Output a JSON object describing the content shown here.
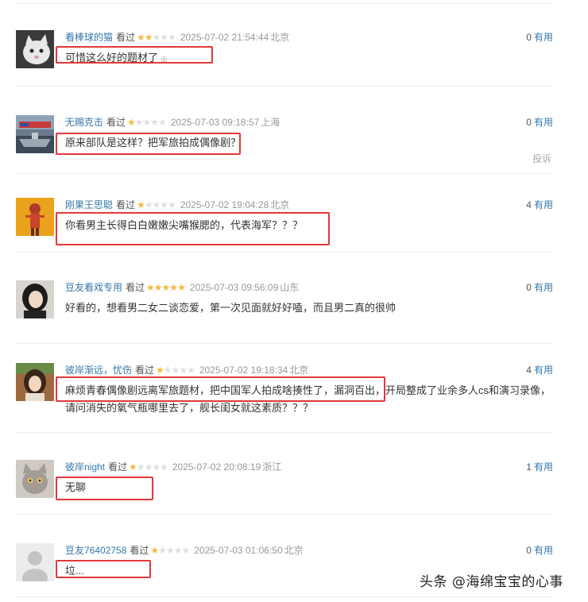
{
  "reviews": [
    {
      "user": "看棒球的猫",
      "seen": "看过",
      "rating": 2,
      "time": "2025-07-02 21:54:44",
      "location": "北京",
      "useful_count": "0",
      "useful_label": "有用",
      "content": "可惜这么好的题材了",
      "avatar_icon": "cat-avatar-icon"
    },
    {
      "user": "无赐克击",
      "seen": "看过",
      "rating": 1,
      "time": "2025-07-03 09:18:57",
      "location": "上海",
      "useful_count": "0",
      "useful_label": "有用",
      "content": "原来部队是这样？把军旅拍成偶像剧？",
      "report_label": "投诉",
      "avatar_icon": "ship-avatar-icon"
    },
    {
      "user": "刚果王思聪",
      "seen": "看过",
      "rating": 1,
      "time": "2025-07-02 19:04:28",
      "location": "北京",
      "useful_count": "4",
      "useful_label": "有用",
      "content": "你看男主长得白白嫩嫩尖嘴猴腮的，代表海军？？？",
      "avatar_icon": "figure-avatar-icon"
    },
    {
      "user": "豆友看戏专用",
      "seen": "看过",
      "rating": 5,
      "time": "2025-07-03 09:56:09",
      "location": "山东",
      "useful_count": "0",
      "useful_label": "有用",
      "content": "好看的，想看男二女二谈恋爱，第一次见面就好好嗑，而且男二真的很帅",
      "avatar_icon": "woman-avatar-icon"
    },
    {
      "user": "彼岸渐远，忧伤",
      "seen": "看过",
      "rating": 1,
      "time": "2025-07-02 19:18:34",
      "location": "北京",
      "useful_count": "4",
      "useful_label": "有用",
      "content": "麻烦青春偶像剧远离军旅题材，把中国军人拍成啥揍性了，漏洞百出，开局整成了业余多人cs和演习录像，请问消失的氧气瓶哪里去了，舰长闺女就这素质？？？",
      "avatar_icon": "girl-avatar-icon"
    },
    {
      "user": "彼岸night",
      "seen": "看过",
      "rating": 1,
      "time": "2025-07-02 20:08:19",
      "location": "浙江",
      "useful_count": "1",
      "useful_label": "有用",
      "content": "无聊",
      "avatar_icon": "cat-photo-avatar-icon"
    },
    {
      "user": "豆友76402758",
      "seen": "看过",
      "rating": 1,
      "time": "2025-07-03 01:06:50",
      "location": "北京",
      "useful_count": "0",
      "useful_label": "有用",
      "content": "垃...",
      "avatar_icon": "default-person-avatar-icon"
    }
  ],
  "watermark": "头条 @海绵宝宝的心事",
  "colors": {
    "link": "#3377aa",
    "star": "#f6b83a",
    "highlight": "#e2383a"
  }
}
